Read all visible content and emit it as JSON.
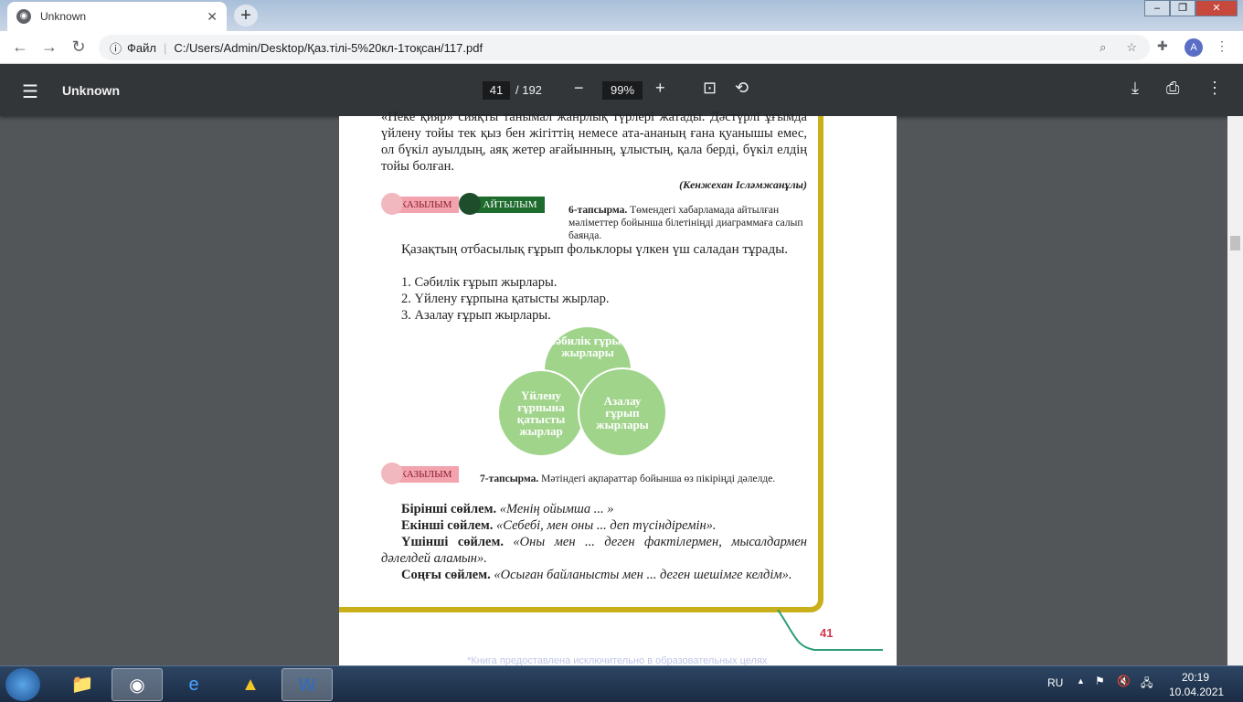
{
  "browser": {
    "tab_title": "Unknown",
    "new_tab": "+",
    "close_tab": "✕",
    "address_scheme": "Файл",
    "url": "C:/Users/Admin/Desktop/Қаз.тілі-5%20кл-1тоқсан/117.pdf",
    "profile_initial": "A"
  },
  "pdf_toolbar": {
    "title": "Unknown",
    "page_current": "41",
    "page_total": "/ 192",
    "zoom": "99%"
  },
  "document": {
    "para_top": "«Неке қияр» сияқты танымал жанрлық түрлері жатады. Дәстүрлі ұғымда үйлену тойы тек қыз бен жігіттің немесе ата-ананың ғана қуанышы емес, ол бүкіл ауылдың, аяқ жетер ағайынның, ұлыстың, қала берді, бүкіл елдің тойы болған.",
    "author": "(Кенжехан Ісләмжанұлы)",
    "badge_writing": "ЖАЗЫЛЫМ",
    "badge_speaking": "АЙТЫЛЫМ",
    "task6_label": "6-тапсырма.",
    "task6_text": "Төмендегі хабарламада айтылған мәліметтер бойынша білетініңді диаграммаға салып баянда.",
    "intro": "Қазақтың отбасылық ғұрып фольклоры үлкен үш саладан тұрады.",
    "list": [
      "1. Сәбилік ғұрып жырлары.",
      "2. Үйлену ғұрпына қатысты жырлар.",
      "3. Азалау ғұрып жырлары."
    ],
    "venn": [
      "Сәбилік ғұрып жырлары",
      "Үйлену ғұрпына қатысты жырлар",
      "Азалау ғұрып жырлары"
    ],
    "task7_label": "7-тапсырма.",
    "task7_text": "Мәтіндегі ақпараттар бойынша өз пікіріңді дәлелде.",
    "sentences": [
      {
        "label": "Бірінші сөйлем.",
        "text": "«Менің ойымша ... »"
      },
      {
        "label": "Екінші сөйлем.",
        "text": "«Себебі, мен оны ... деп түсіндіремін»."
      },
      {
        "label": "Үшінші сөйлем.",
        "text": "«Оны мен ... деген фактілермен, мысалдармен дәлелдей аламын»."
      },
      {
        "label": "Соңғы сөйлем.",
        "text": "«Осыған байланысты мен ... деген шешімге келдім»."
      }
    ],
    "page_number": "41",
    "footer": "*Книга предоставлена исключительно в образовательных целях"
  },
  "taskbar": {
    "lang": "RU",
    "time": "20:19",
    "date": "10.04.2021"
  }
}
